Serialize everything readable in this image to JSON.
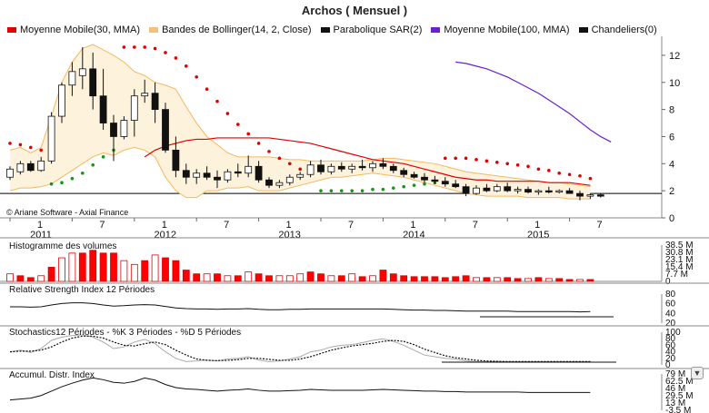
{
  "title": "Archos  ( Mensuel )",
  "legend": [
    {
      "label": "Moyenne Mobile(30, MMA)",
      "color": "#e00000"
    },
    {
      "label": "Bandes de Bollinger(14, 2, Close)",
      "color": "#f5c07a"
    },
    {
      "label": "Parabolique SAR(2)",
      "color": "#111111"
    },
    {
      "label": "Moyenne Mobile(100, MMA)",
      "color": "#6a1fd0"
    },
    {
      "label": "Chandeliers(0)",
      "color": "#111111"
    }
  ],
  "copyright": "© Ariane Software - Axial Finance",
  "panels": {
    "volume": {
      "label": "Histogramme des volumes",
      "ticks": [
        "38.5 M",
        "30.8 M",
        "23.1 M",
        "15.4 M",
        "7.7 M",
        "0"
      ]
    },
    "rsi": {
      "label": "Relative Strength Index 12 Périodes",
      "ticks": [
        "80",
        "60",
        "40",
        "20"
      ]
    },
    "stoch": {
      "label": "Stochastics12 Périodes  -  %K 3 Périodes  -  %D 5 Périodes",
      "ticks": [
        "100",
        "80",
        "60",
        "40",
        "20",
        "0"
      ]
    },
    "adi": {
      "label": "Accumul. Distr. Index",
      "ticks": [
        "79 M",
        "62.5 M",
        "46 M",
        "29.5 M",
        "13 M",
        "-3.5 M"
      ]
    }
  },
  "chart_data": {
    "type": "candlestick",
    "title": "Archos  ( Mensuel )",
    "ylim": [
      0,
      13
    ],
    "yticks": [
      0,
      2,
      4,
      6,
      8,
      10,
      12
    ],
    "last_price_line": 1.8,
    "x_ticks": [
      {
        "i": 0,
        "label": "1"
      },
      {
        "i": 6,
        "label": "7"
      },
      {
        "i": 12,
        "label": "1"
      },
      {
        "i": 18,
        "label": "7"
      },
      {
        "i": 24,
        "label": "1"
      },
      {
        "i": 30,
        "label": "7"
      },
      {
        "i": 36,
        "label": "1"
      },
      {
        "i": 42,
        "label": "7"
      },
      {
        "i": 48,
        "label": "1"
      },
      {
        "i": 54,
        "label": "7"
      }
    ],
    "year_labels": [
      {
        "i": 0,
        "label": "2011"
      },
      {
        "i": 12,
        "label": "2012"
      },
      {
        "i": 24,
        "label": "2013"
      },
      {
        "i": 36,
        "label": "2014"
      },
      {
        "i": 48,
        "label": "2015"
      }
    ],
    "candles": [
      {
        "o": 3.0,
        "h": 3.8,
        "l": 2.8,
        "c": 3.6
      },
      {
        "o": 3.4,
        "h": 4.2,
        "l": 3.2,
        "c": 4.0
      },
      {
        "o": 4.0,
        "h": 4.2,
        "l": 3.4,
        "c": 3.5
      },
      {
        "o": 3.5,
        "h": 4.5,
        "l": 3.4,
        "c": 4.2
      },
      {
        "o": 4.2,
        "h": 7.8,
        "l": 4.0,
        "c": 7.5
      },
      {
        "o": 7.5,
        "h": 10.0,
        "l": 7.0,
        "c": 9.8
      },
      {
        "o": 9.8,
        "h": 11.5,
        "l": 9.0,
        "c": 10.8
      },
      {
        "o": 10.5,
        "h": 12.6,
        "l": 9.5,
        "c": 11.0
      },
      {
        "o": 11.0,
        "h": 12.2,
        "l": 8.0,
        "c": 9.0
      },
      {
        "o": 9.0,
        "h": 11.0,
        "l": 6.5,
        "c": 7.0
      },
      {
        "o": 7.0,
        "h": 7.6,
        "l": 4.2,
        "c": 6.0
      },
      {
        "o": 6.0,
        "h": 7.5,
        "l": 5.8,
        "c": 7.2
      },
      {
        "o": 7.2,
        "h": 9.5,
        "l": 6.0,
        "c": 9.0
      },
      {
        "o": 9.0,
        "h": 10.2,
        "l": 8.5,
        "c": 9.2
      },
      {
        "o": 9.2,
        "h": 10.0,
        "l": 7.0,
        "c": 8.0
      },
      {
        "o": 8.0,
        "h": 8.5,
        "l": 4.8,
        "c": 5.0
      },
      {
        "o": 5.0,
        "h": 6.0,
        "l": 3.0,
        "c": 3.5
      },
      {
        "o": 3.5,
        "h": 4.0,
        "l": 2.5,
        "c": 3.0
      },
      {
        "o": 3.0,
        "h": 3.6,
        "l": 2.5,
        "c": 3.3
      },
      {
        "o": 3.3,
        "h": 3.8,
        "l": 2.8,
        "c": 3.0
      },
      {
        "o": 3.0,
        "h": 3.5,
        "l": 2.2,
        "c": 2.8
      },
      {
        "o": 2.8,
        "h": 3.6,
        "l": 2.6,
        "c": 3.4
      },
      {
        "o": 3.4,
        "h": 4.0,
        "l": 3.0,
        "c": 3.3
      },
      {
        "o": 3.3,
        "h": 4.6,
        "l": 3.0,
        "c": 3.8
      },
      {
        "o": 3.8,
        "h": 4.2,
        "l": 2.6,
        "c": 2.8
      },
      {
        "o": 2.8,
        "h": 3.0,
        "l": 2.2,
        "c": 2.4
      },
      {
        "o": 2.4,
        "h": 2.8,
        "l": 2.2,
        "c": 2.6
      },
      {
        "o": 2.6,
        "h": 3.2,
        "l": 2.4,
        "c": 3.0
      },
      {
        "o": 3.0,
        "h": 3.4,
        "l": 2.8,
        "c": 3.2
      },
      {
        "o": 3.2,
        "h": 4.2,
        "l": 3.0,
        "c": 3.9
      },
      {
        "o": 3.9,
        "h": 4.3,
        "l": 3.2,
        "c": 3.4
      },
      {
        "o": 3.4,
        "h": 4.0,
        "l": 3.2,
        "c": 3.8
      },
      {
        "o": 3.8,
        "h": 4.1,
        "l": 3.4,
        "c": 3.6
      },
      {
        "o": 3.6,
        "h": 4.0,
        "l": 3.3,
        "c": 3.8
      },
      {
        "o": 3.8,
        "h": 4.3,
        "l": 3.5,
        "c": 3.7
      },
      {
        "o": 3.7,
        "h": 4.2,
        "l": 3.4,
        "c": 4.0
      },
      {
        "o": 4.0,
        "h": 4.4,
        "l": 3.6,
        "c": 3.8
      },
      {
        "o": 3.8,
        "h": 4.0,
        "l": 3.3,
        "c": 3.5
      },
      {
        "o": 3.5,
        "h": 3.7,
        "l": 3.0,
        "c": 3.2
      },
      {
        "o": 3.2,
        "h": 3.4,
        "l": 2.9,
        "c": 3.0
      },
      {
        "o": 3.0,
        "h": 3.3,
        "l": 2.6,
        "c": 2.8
      },
      {
        "o": 2.8,
        "h": 3.1,
        "l": 2.5,
        "c": 2.7
      },
      {
        "o": 2.7,
        "h": 3.0,
        "l": 2.3,
        "c": 2.5
      },
      {
        "o": 2.5,
        "h": 2.8,
        "l": 2.2,
        "c": 2.3
      },
      {
        "o": 2.3,
        "h": 2.5,
        "l": 1.6,
        "c": 1.8
      },
      {
        "o": 1.8,
        "h": 2.4,
        "l": 1.7,
        "c": 2.2
      },
      {
        "o": 2.2,
        "h": 2.5,
        "l": 1.9,
        "c": 2.0
      },
      {
        "o": 2.0,
        "h": 2.5,
        "l": 1.9,
        "c": 2.3
      },
      {
        "o": 2.3,
        "h": 2.6,
        "l": 1.9,
        "c": 2.0
      },
      {
        "o": 2.0,
        "h": 2.3,
        "l": 1.8,
        "c": 2.1
      },
      {
        "o": 2.1,
        "h": 2.3,
        "l": 1.8,
        "c": 1.9
      },
      {
        "o": 1.9,
        "h": 2.1,
        "l": 1.7,
        "c": 2.0
      },
      {
        "o": 2.0,
        "h": 2.3,
        "l": 1.8,
        "c": 1.9
      },
      {
        "o": 1.9,
        "h": 2.1,
        "l": 1.8,
        "c": 2.0
      },
      {
        "o": 2.0,
        "h": 2.2,
        "l": 1.8,
        "c": 1.8
      },
      {
        "o": 1.8,
        "h": 2.0,
        "l": 1.3,
        "c": 1.6
      },
      {
        "o": 1.6,
        "h": 1.8,
        "l": 1.4,
        "c": 1.7
      },
      {
        "o": 1.7,
        "h": 1.8,
        "l": 1.5,
        "c": 1.6
      }
    ],
    "volumes_m": [
      8,
      6,
      4,
      6,
      15,
      25,
      30,
      30,
      33,
      30,
      30,
      22,
      18,
      22,
      28,
      25,
      22,
      12,
      8,
      8,
      8,
      6,
      6,
      10,
      8,
      6,
      6,
      6,
      8,
      10,
      8,
      6,
      6,
      8,
      5,
      6,
      12,
      8,
      6,
      5,
      5,
      5,
      4,
      5,
      6,
      4,
      4,
      4,
      4,
      3,
      3,
      4,
      3,
      3,
      2,
      2,
      2
    ],
    "volume_colors": [
      "#ffffff",
      "#ff0000",
      "#ff0000",
      "#ffffff",
      "#ff0000",
      "#ffffff",
      "#ffffff",
      "#ff0000",
      "#ff0000",
      "#ff0000",
      "#ff0000",
      "#ffffff",
      "#ffffff",
      "#ff0000",
      "#ffffff",
      "#ff0000",
      "#ff0000",
      "#ff0000",
      "#ff0000",
      "#ffffff",
      "#ff0000",
      "#ffffff",
      "#ff0000",
      "#ffffff",
      "#ff0000",
      "#ff0000",
      "#ffffff",
      "#ffffff",
      "#ffffff",
      "#ff0000",
      "#ff0000",
      "#ffffff",
      "#ff0000",
      "#ffffff",
      "#ff0000",
      "#ffffff",
      "#ff0000",
      "#ff0000",
      "#ff0000",
      "#ff0000",
      "#ff0000",
      "#ff0000",
      "#ff0000",
      "#ff0000",
      "#ff0000",
      "#ffffff",
      "#ff0000",
      "#ffffff",
      "#ff0000",
      "#ff0000",
      "#ffffff",
      "#ff0000",
      "#ffffff",
      "#ff0000",
      "#ff0000",
      "#ffffff",
      "#ff0000"
    ],
    "ma30": [
      null,
      null,
      null,
      null,
      null,
      null,
      null,
      null,
      null,
      null,
      null,
      null,
      null,
      4.5,
      5.0,
      5.3,
      5.5,
      5.7,
      5.8,
      5.8,
      5.9,
      5.9,
      5.9,
      5.9,
      5.9,
      5.9,
      5.8,
      5.7,
      5.6,
      5.5,
      5.3,
      5.1,
      4.9,
      4.7,
      4.5,
      4.3,
      4.2,
      4.1,
      4.0,
      3.8,
      3.6,
      3.4,
      3.2,
      3.0,
      2.9,
      2.8,
      2.8,
      2.7,
      2.7,
      2.7,
      2.7,
      2.7,
      2.6,
      2.6,
      2.6,
      2.5,
      2.4
    ],
    "ma100": [
      null,
      null,
      null,
      null,
      null,
      null,
      null,
      null,
      null,
      null,
      null,
      null,
      null,
      null,
      null,
      null,
      null,
      null,
      null,
      null,
      null,
      null,
      null,
      null,
      null,
      null,
      null,
      null,
      null,
      null,
      null,
      null,
      null,
      null,
      null,
      null,
      null,
      null,
      null,
      null,
      null,
      null,
      null,
      11.5,
      11.4,
      11.2,
      11.0,
      10.7,
      10.4,
      10.0,
      9.6,
      9.2,
      8.7,
      8.2,
      7.7,
      7.1,
      6.5,
      6.0,
      5.6
    ],
    "bb_upper": [
      5.0,
      5.2,
      4.8,
      5.2,
      7.5,
      10.0,
      11.5,
      12.5,
      12.8,
      12.4,
      12.0,
      11.5,
      10.8,
      10.5,
      10.0,
      9.8,
      9.5,
      8.2,
      7.0,
      6.0,
      5.4,
      4.8,
      4.5,
      4.5,
      4.5,
      4.5,
      4.4,
      4.3,
      4.3,
      4.2,
      4.2,
      4.2,
      4.2,
      4.2,
      4.2,
      4.3,
      4.4,
      4.4,
      4.3,
      4.2,
      4.1,
      4.0,
      3.8,
      3.6,
      3.4,
      3.3,
      3.2,
      3.1,
      3.0,
      2.9,
      2.8,
      2.7,
      2.6,
      2.6,
      2.5,
      2.4,
      2.3
    ],
    "bb_lower": [
      2.0,
      2.2,
      2.2,
      2.3,
      2.5,
      3.0,
      3.5,
      4.0,
      4.5,
      4.8,
      4.6,
      5.0,
      5.2,
      5.0,
      4.5,
      3.0,
      2.0,
      1.5,
      1.5,
      2.0,
      2.0,
      2.2,
      2.2,
      2.3,
      2.0,
      2.0,
      2.0,
      2.2,
      2.4,
      2.6,
      2.8,
      3.0,
      3.0,
      3.1,
      3.2,
      3.3,
      3.2,
      3.1,
      3.0,
      2.8,
      2.6,
      2.4,
      2.2,
      2.0,
      1.8,
      1.7,
      1.6,
      1.6,
      1.6,
      1.6,
      1.5,
      1.5,
      1.5,
      1.5,
      1.4,
      1.4,
      1.4
    ],
    "sar": [
      5.5,
      5.4,
      5.2,
      5.0,
      2.5,
      2.6,
      2.9,
      3.3,
      3.9,
      4.5,
      5.0,
      12.6,
      12.6,
      12.6,
      12.5,
      12.2,
      11.8,
      11.2,
      10.4,
      9.5,
      8.6,
      7.7,
      6.9,
      6.2,
      5.5,
      4.9,
      4.4,
      4.0,
      3.6,
      3.3,
      2.0,
      2.0,
      2.0,
      2.0,
      2.0,
      2.1,
      2.1,
      2.2,
      2.3,
      2.4,
      2.5,
      2.6,
      4.4,
      4.4,
      4.4,
      4.3,
      4.2,
      4.1,
      4.0,
      3.9,
      3.8,
      3.6,
      3.5,
      3.3,
      3.2,
      3.1,
      2.9
    ]
  }
}
